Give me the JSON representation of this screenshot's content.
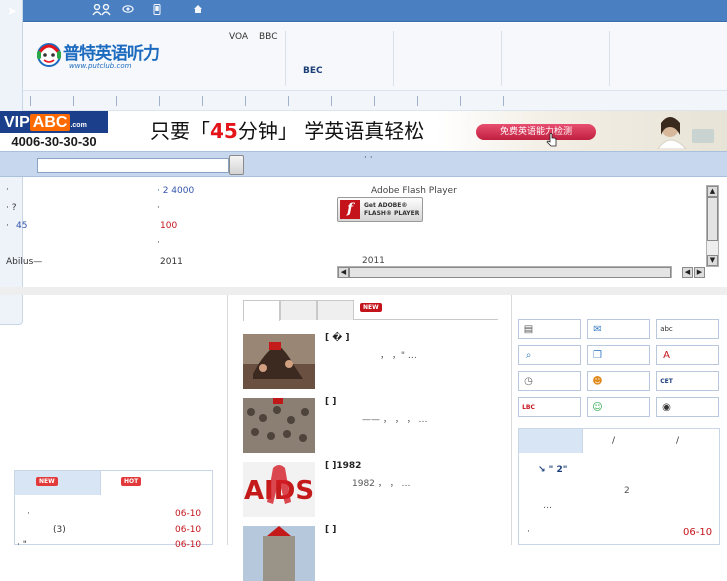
{
  "topbar": {
    "arrow": "➤",
    "icons": [
      "people-icon",
      "eye-icon",
      "phone-icon",
      "home-icon"
    ]
  },
  "header": {
    "logo_text": "普特英语听力",
    "logo_url": "www.putclub.com",
    "links": [
      "VOA",
      "BBC"
    ],
    "link_bec": "BEC"
  },
  "banner": {
    "vip": "VIP",
    "abc": "ABC",
    "com": ".com",
    "phone": "4006-30-30-30",
    "slogan_pre": "只要「",
    "slogan_num": "45",
    "slogan_mid": "分钟」 学英语真轻松",
    "button": "免费英语能力检测"
  },
  "searchbar": {
    "hint": "·  ·"
  },
  "news_left": {
    "col1": [
      "·",
      "·    ?",
      "·",
      "45",
      "Abilus—"
    ],
    "col2_a": "·    2   4000",
    "col2_b": "·",
    "col2_c": "100",
    "col2_d": "·",
    "col2_e": "2011"
  },
  "flash": {
    "label": "Adobe Flash Player",
    "get": "Get ADOBE®",
    "player": "FLASH® PLAYER",
    "year": "2011"
  },
  "left_panel": {
    "tab_new": "NEW",
    "tab_hot": "HOT",
    "rows": [
      {
        "text": "·",
        "date": "06-10"
      },
      {
        "text": "(3)",
        "date": "06-10"
      },
      {
        "text": "·  \"",
        "date": "06-10"
      }
    ]
  },
  "middle": {
    "badge": "NEW",
    "items": [
      {
        "title": "[   �  ]",
        "desc": "，   ，\"  …"
      },
      {
        "title": "[      ]",
        "desc": "——    ，   ，   ，  …"
      },
      {
        "title": "[      ]1982",
        "desc": "1982    ，   ，      …"
      },
      {
        "title": "[      ]",
        "desc": ""
      }
    ]
  },
  "right": {
    "grid_icons": [
      "radio-icon",
      "chat-icon",
      "abc-icon",
      "search-icon",
      "document-icon",
      "dictionary-icon",
      "clock-icon",
      "user-icon",
      "cet-icon",
      "lbc-icon",
      "group-icon",
      "eye-icon"
    ],
    "grid_labels": [
      "abc"
    ],
    "tabs_sep": [
      "/",
      "/"
    ],
    "headline": "↘  \"  2\"",
    "num": "2",
    "dots": "…",
    "row_text": "·",
    "row_date": "06-10"
  }
}
